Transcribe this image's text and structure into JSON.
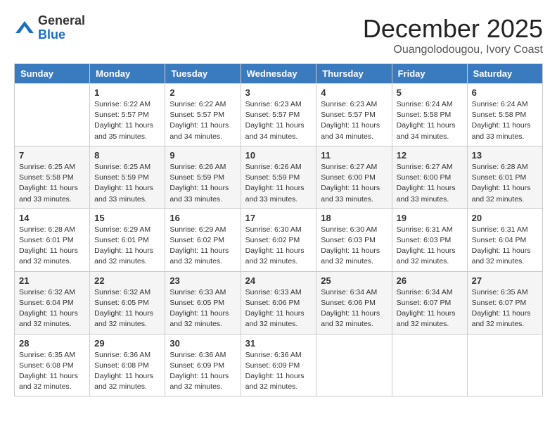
{
  "header": {
    "logo_general": "General",
    "logo_blue": "Blue",
    "month": "December 2025",
    "location": "Ouangolodougou, Ivory Coast"
  },
  "weekdays": [
    "Sunday",
    "Monday",
    "Tuesday",
    "Wednesday",
    "Thursday",
    "Friday",
    "Saturday"
  ],
  "weeks": [
    [
      {
        "day": "",
        "info": ""
      },
      {
        "day": "1",
        "info": "Sunrise: 6:22 AM\nSunset: 5:57 PM\nDaylight: 11 hours\nand 35 minutes."
      },
      {
        "day": "2",
        "info": "Sunrise: 6:22 AM\nSunset: 5:57 PM\nDaylight: 11 hours\nand 34 minutes."
      },
      {
        "day": "3",
        "info": "Sunrise: 6:23 AM\nSunset: 5:57 PM\nDaylight: 11 hours\nand 34 minutes."
      },
      {
        "day": "4",
        "info": "Sunrise: 6:23 AM\nSunset: 5:57 PM\nDaylight: 11 hours\nand 34 minutes."
      },
      {
        "day": "5",
        "info": "Sunrise: 6:24 AM\nSunset: 5:58 PM\nDaylight: 11 hours\nand 34 minutes."
      },
      {
        "day": "6",
        "info": "Sunrise: 6:24 AM\nSunset: 5:58 PM\nDaylight: 11 hours\nand 33 minutes."
      }
    ],
    [
      {
        "day": "7",
        "info": "Sunrise: 6:25 AM\nSunset: 5:58 PM\nDaylight: 11 hours\nand 33 minutes."
      },
      {
        "day": "8",
        "info": "Sunrise: 6:25 AM\nSunset: 5:59 PM\nDaylight: 11 hours\nand 33 minutes."
      },
      {
        "day": "9",
        "info": "Sunrise: 6:26 AM\nSunset: 5:59 PM\nDaylight: 11 hours\nand 33 minutes."
      },
      {
        "day": "10",
        "info": "Sunrise: 6:26 AM\nSunset: 5:59 PM\nDaylight: 11 hours\nand 33 minutes."
      },
      {
        "day": "11",
        "info": "Sunrise: 6:27 AM\nSunset: 6:00 PM\nDaylight: 11 hours\nand 33 minutes."
      },
      {
        "day": "12",
        "info": "Sunrise: 6:27 AM\nSunset: 6:00 PM\nDaylight: 11 hours\nand 33 minutes."
      },
      {
        "day": "13",
        "info": "Sunrise: 6:28 AM\nSunset: 6:01 PM\nDaylight: 11 hours\nand 32 minutes."
      }
    ],
    [
      {
        "day": "14",
        "info": "Sunrise: 6:28 AM\nSunset: 6:01 PM\nDaylight: 11 hours\nand 32 minutes."
      },
      {
        "day": "15",
        "info": "Sunrise: 6:29 AM\nSunset: 6:01 PM\nDaylight: 11 hours\nand 32 minutes."
      },
      {
        "day": "16",
        "info": "Sunrise: 6:29 AM\nSunset: 6:02 PM\nDaylight: 11 hours\nand 32 minutes."
      },
      {
        "day": "17",
        "info": "Sunrise: 6:30 AM\nSunset: 6:02 PM\nDaylight: 11 hours\nand 32 minutes."
      },
      {
        "day": "18",
        "info": "Sunrise: 6:30 AM\nSunset: 6:03 PM\nDaylight: 11 hours\nand 32 minutes."
      },
      {
        "day": "19",
        "info": "Sunrise: 6:31 AM\nSunset: 6:03 PM\nDaylight: 11 hours\nand 32 minutes."
      },
      {
        "day": "20",
        "info": "Sunrise: 6:31 AM\nSunset: 6:04 PM\nDaylight: 11 hours\nand 32 minutes."
      }
    ],
    [
      {
        "day": "21",
        "info": "Sunrise: 6:32 AM\nSunset: 6:04 PM\nDaylight: 11 hours\nand 32 minutes."
      },
      {
        "day": "22",
        "info": "Sunrise: 6:32 AM\nSunset: 6:05 PM\nDaylight: 11 hours\nand 32 minutes."
      },
      {
        "day": "23",
        "info": "Sunrise: 6:33 AM\nSunset: 6:05 PM\nDaylight: 11 hours\nand 32 minutes."
      },
      {
        "day": "24",
        "info": "Sunrise: 6:33 AM\nSunset: 6:06 PM\nDaylight: 11 hours\nand 32 minutes."
      },
      {
        "day": "25",
        "info": "Sunrise: 6:34 AM\nSunset: 6:06 PM\nDaylight: 11 hours\nand 32 minutes."
      },
      {
        "day": "26",
        "info": "Sunrise: 6:34 AM\nSunset: 6:07 PM\nDaylight: 11 hours\nand 32 minutes."
      },
      {
        "day": "27",
        "info": "Sunrise: 6:35 AM\nSunset: 6:07 PM\nDaylight: 11 hours\nand 32 minutes."
      }
    ],
    [
      {
        "day": "28",
        "info": "Sunrise: 6:35 AM\nSunset: 6:08 PM\nDaylight: 11 hours\nand 32 minutes."
      },
      {
        "day": "29",
        "info": "Sunrise: 6:36 AM\nSunset: 6:08 PM\nDaylight: 11 hours\nand 32 minutes."
      },
      {
        "day": "30",
        "info": "Sunrise: 6:36 AM\nSunset: 6:09 PM\nDaylight: 11 hours\nand 32 minutes."
      },
      {
        "day": "31",
        "info": "Sunrise: 6:36 AM\nSunset: 6:09 PM\nDaylight: 11 hours\nand 32 minutes."
      },
      {
        "day": "",
        "info": ""
      },
      {
        "day": "",
        "info": ""
      },
      {
        "day": "",
        "info": ""
      }
    ]
  ]
}
